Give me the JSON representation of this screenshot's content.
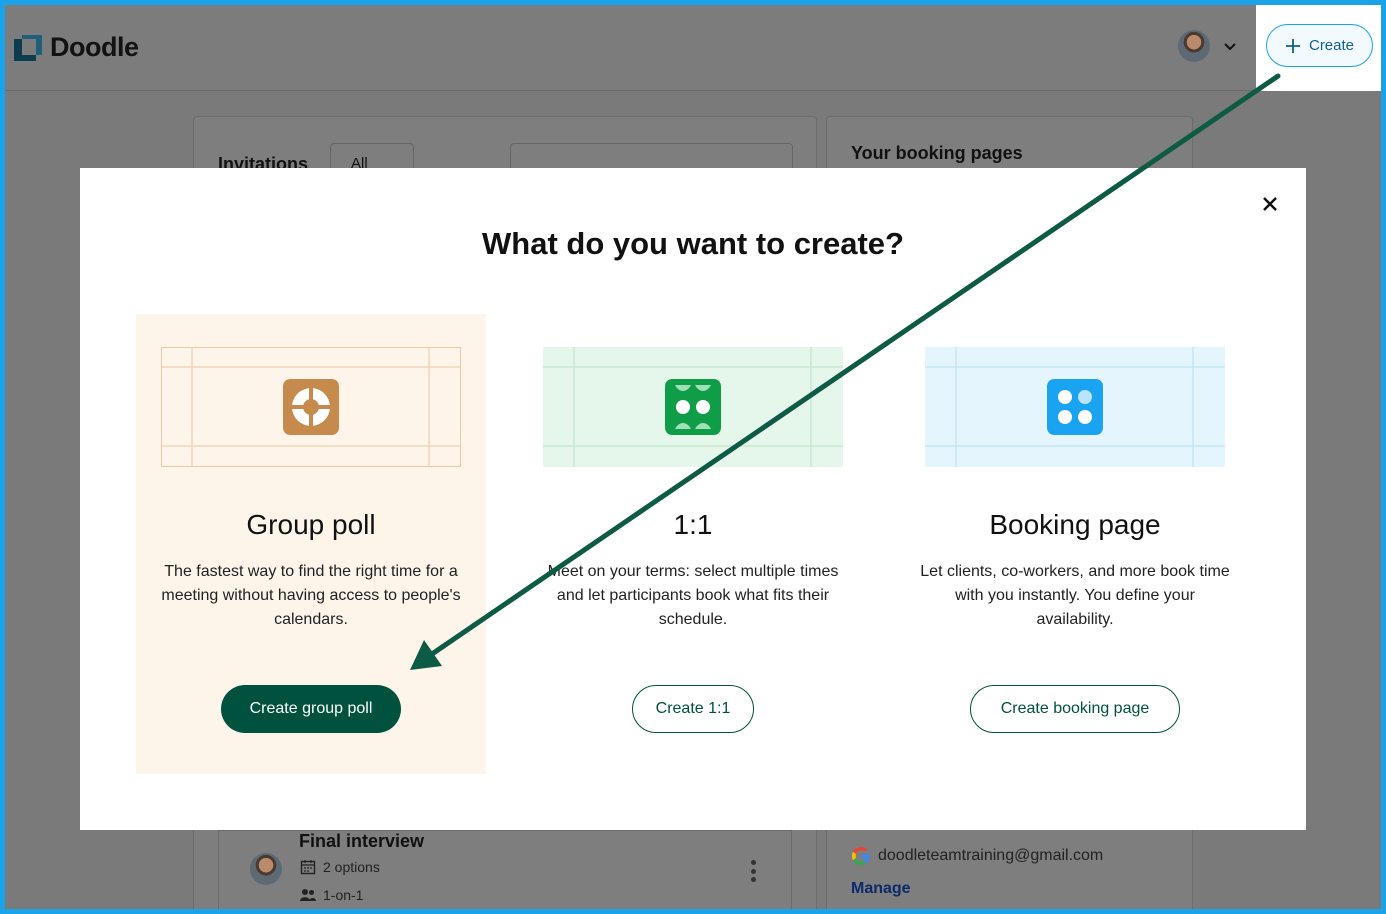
{
  "header": {
    "logo_text": "Doodle",
    "create_label": "Create"
  },
  "background": {
    "invitations_label": "Invitations",
    "filter_value": "All",
    "booking_title": "Your booking pages",
    "event": {
      "title": "Final interview",
      "options": "2 options",
      "kind": "1-on-1"
    },
    "account_email": "doodleteamtraining@gmail.com",
    "manage_label": "Manage"
  },
  "modal": {
    "title": "What do you want to create?",
    "options": [
      {
        "title": "Group poll",
        "description": "The fastest way to find the right time for a meeting without having access to people's calendars.",
        "button": "Create group poll",
        "accent": "#c68a4c"
      },
      {
        "title": "1:1",
        "description": "Meet on your terms: select multiple times and let participants book what fits their schedule.",
        "button": "Create 1:1",
        "accent": "#0f9d48"
      },
      {
        "title": "Booking page",
        "description": "Let clients, co-workers, and more book time with you instantly. You define your availability.",
        "button": "Create booking page",
        "accent": "#1aa3f0"
      }
    ]
  },
  "icons": [
    "doodle-logo",
    "chevron-down-icon",
    "plus-icon",
    "close-icon",
    "calendar-icon",
    "people-icon",
    "kebab-icon",
    "google-icon",
    "poll-icon",
    "one-on-one-icon",
    "booking-page-icon",
    "annotation-arrow"
  ],
  "colors": {
    "frame": "#1aa3e8",
    "primary": "#00513d",
    "arrow": "#0d5a45",
    "overlay": "#7a7a7a"
  }
}
